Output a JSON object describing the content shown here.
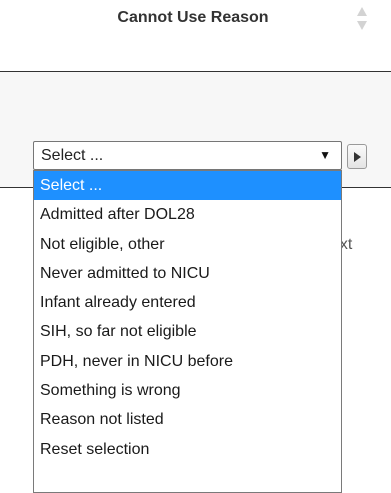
{
  "column_header": {
    "title": "Cannot Use Reason"
  },
  "reason_select": {
    "value": "Select ...",
    "arrow": "▼",
    "options": [
      "Select ...",
      "Admitted after DOL28",
      "Not eligible, other",
      "Never admitted to NICU",
      "Infant already entered",
      "SIH, so far not eligible",
      "PDH, never in NICU before",
      "Something is wrong",
      "Reason not listed",
      "Reset selection"
    ],
    "selected_index": 0
  },
  "background_text": {
    "partial_label": "ext"
  },
  "colors": {
    "highlight": "#1e90ff",
    "row_background": "#f7f7f7",
    "divider": "#333333"
  },
  "icons": {
    "sort": "sort-icon",
    "next": "play-right-icon"
  }
}
